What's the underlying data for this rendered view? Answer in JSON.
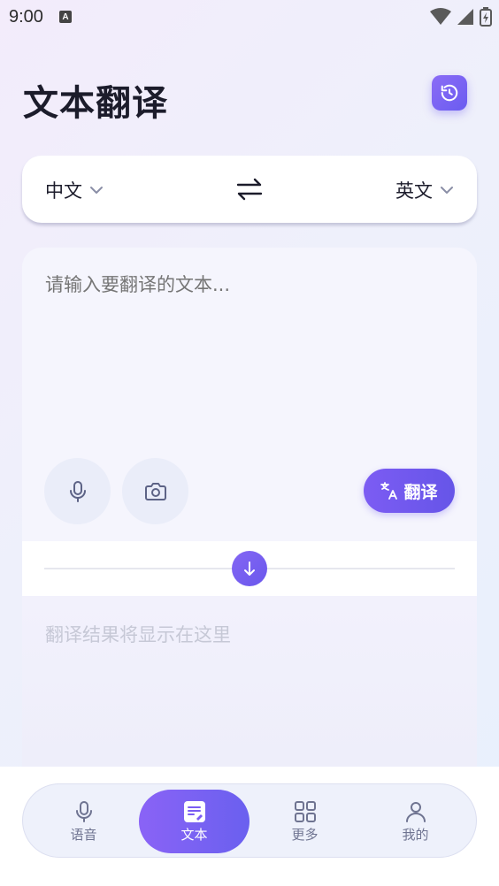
{
  "status_bar": {
    "time": "9:00",
    "notification_icon": "A"
  },
  "header": {
    "title": "文本翻译",
    "history_icon": "history-icon"
  },
  "language_selector": {
    "source_language": "中文",
    "target_language": "英文",
    "swap_icon": "swap-icon"
  },
  "input": {
    "placeholder": "请输入要翻译的文本...",
    "value": "",
    "translate_label": "翻译"
  },
  "result": {
    "placeholder": "翻译结果将显示在这里"
  },
  "bottom_nav": {
    "items": [
      {
        "label": "语音",
        "icon": "mic-icon",
        "active": false
      },
      {
        "label": "文本",
        "icon": "document-icon",
        "active": true
      },
      {
        "label": "更多",
        "icon": "grid-icon",
        "active": false
      },
      {
        "label": "我的",
        "icon": "user-icon",
        "active": false
      }
    ]
  },
  "colors": {
    "accent": "#7a5cf3",
    "placeholder": "#c6c8d6",
    "nav_inactive": "#6f7491"
  }
}
